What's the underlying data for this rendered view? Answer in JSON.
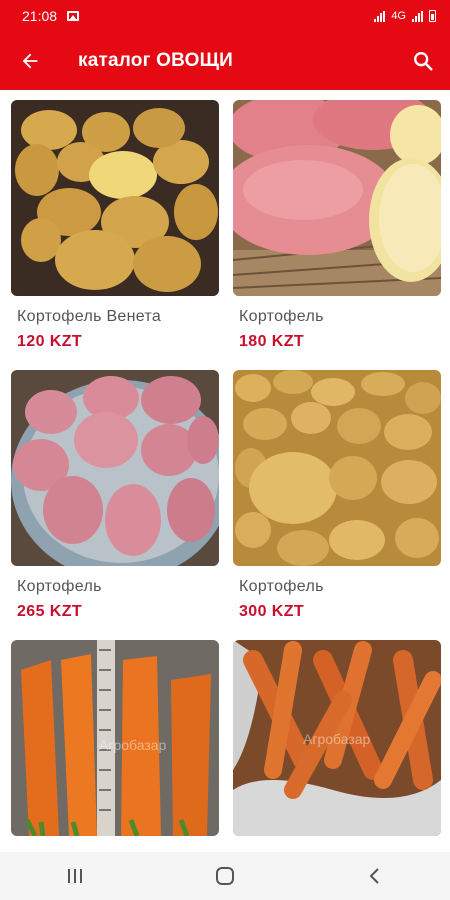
{
  "status_bar": {
    "time": "21:08",
    "network": "4G"
  },
  "app_bar": {
    "title": "каталог ОВОЩИ"
  },
  "products": [
    {
      "name": "Кортофель Венета",
      "price": "120 KZT",
      "image": "potatoes-yellow-on-soil"
    },
    {
      "name": "Кортофель",
      "price": "180 KZT",
      "image": "red-potatoes-cut"
    },
    {
      "name": "Кортофель",
      "price": "265 KZT",
      "image": "pink-potatoes-in-basin"
    },
    {
      "name": "Кортофель",
      "price": "300 KZT",
      "image": "yellow-potatoes-pile"
    },
    {
      "name": "",
      "price": "",
      "image": "carrots-with-ruler",
      "watermark": "Агробазар"
    },
    {
      "name": "",
      "price": "",
      "image": "carrots-in-sack",
      "watermark": "Агробазар"
    }
  ],
  "icons": {
    "back": "arrow-left-icon",
    "search": "search-icon",
    "recents": "recents-icon",
    "home": "home-icon",
    "nav_back": "chevron-left-icon"
  },
  "colors": {
    "primary": "#e50914",
    "price": "#c8102e",
    "text": "#555555"
  }
}
